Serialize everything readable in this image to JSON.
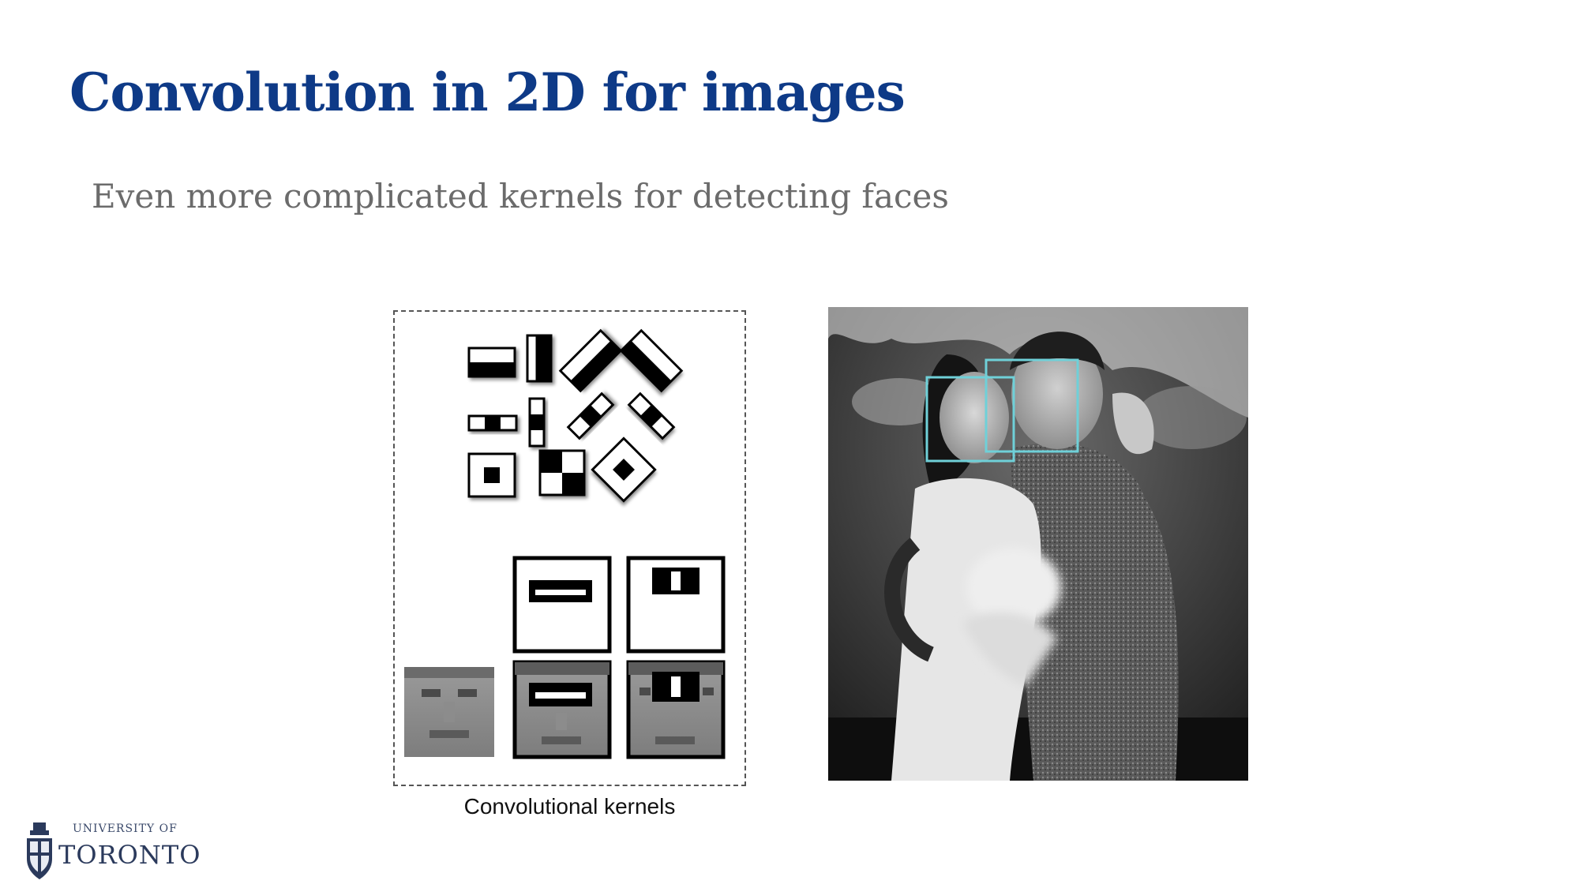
{
  "slide": {
    "title": "Convolution in 2D for images",
    "subtitle": "Even more complicated kernels for detecting faces"
  },
  "figure": {
    "kernels_caption": "Convolutional kernels"
  },
  "logo": {
    "line1": "UNIVERSITY OF",
    "line2": "TORONTO"
  },
  "colors": {
    "title": "#0e3a87",
    "subtitle": "#6b6b6b",
    "detection_box": "#6fd0d8"
  }
}
